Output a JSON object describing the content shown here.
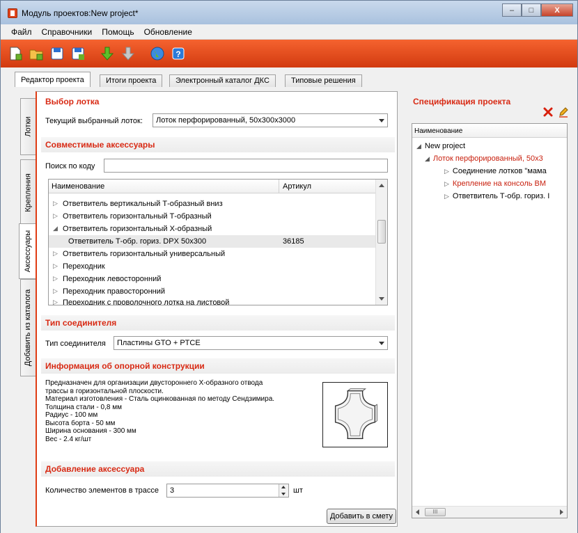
{
  "window": {
    "title": "Модуль проектов:New project*",
    "minimize": "–",
    "maximize": "□",
    "close": "X"
  },
  "menu": [
    "Файл",
    "Справочники",
    "Помощь",
    "Обновление"
  ],
  "toolbar": {
    "icons": [
      "new-document-icon",
      "open-folder-icon",
      "save-icon",
      "save-as-icon",
      "arrow-down-green-icon",
      "arrow-down-gray-icon",
      "globe-icon",
      "help-icon"
    ]
  },
  "tabs": [
    "Редактор проекта",
    "Итоги проекта",
    "Электронный каталог ДКС",
    "Типовые решения"
  ],
  "side_tabs": [
    "Лотки",
    "Крепления",
    "Аксессуары",
    "Добавить из каталога"
  ],
  "tray_selection": {
    "title": "Выбор лотка",
    "label": "Текущий выбранный лоток:",
    "value": "Лоток перфорированный, 50x300x3000"
  },
  "accessories": {
    "title": "Совместимые аксессуары",
    "search_label": "Поиск по коду",
    "search_value": "",
    "columns": [
      "Наименование",
      "Артикул"
    ],
    "rows": [
      {
        "toggle": "▷",
        "name": "Ответвитель вертикальный Т-образный вниз",
        "article": ""
      },
      {
        "toggle": "▷",
        "name": "Ответвитель горизонтальный Т-образный",
        "article": ""
      },
      {
        "toggle": "◢",
        "name": "Ответвитель горизонтальный Х-образный",
        "article": ""
      },
      {
        "toggle": "",
        "name": "Ответвитель Т-обр. гориз. DPX 50x300",
        "article": "36185"
      },
      {
        "toggle": "▷",
        "name": "Ответвитель горизонтальный универсальный",
        "article": ""
      },
      {
        "toggle": "▷",
        "name": "Переходник",
        "article": ""
      },
      {
        "toggle": "▷",
        "name": "Переходник левосторонний",
        "article": ""
      },
      {
        "toggle": "▷",
        "name": "Переходник правосторонний",
        "article": ""
      },
      {
        "toggle": "▷",
        "name": "Переходник с проволочного лотка на листовой",
        "article": ""
      }
    ]
  },
  "connector": {
    "title": "Тип соединителя",
    "label": "Тип соединителя",
    "value": "Пластины GTO + PTCE"
  },
  "support_info": {
    "title": "Информация об опорной конструкции",
    "lines": [
      "Предназначен для организации двустороннего Х-образного отвода",
      "трассы в горизонтальной плоскости.",
      "Материал изготовления - Сталь оцинкованная по методу Сендзимира.",
      "Толщина стали - 0,8 мм",
      "Радиус - 100 мм",
      "Высота борта - 50 мм",
      "Ширина основания - 300 мм",
      "Вес - 2.4 кг/шт"
    ]
  },
  "add_accessory": {
    "title": "Добавление аксессуара",
    "qty_label": "Количество элементов в трассе",
    "qty_value": "3",
    "unit": "шт",
    "button": "Добавить в смету"
  },
  "specification": {
    "title": "Спецификация проекта",
    "column": "Наименование",
    "nodes": [
      {
        "toggle": "◢",
        "label": "New project",
        "red": false,
        "level": 0
      },
      {
        "toggle": "◢",
        "label": "Лоток перфорированный, 50x3",
        "red": true,
        "level": 1
      },
      {
        "toggle": "▷",
        "label": "Соединение лотков \"мама",
        "red": false,
        "level": 2
      },
      {
        "toggle": "▷",
        "label": "Крепление на консоль ВМ",
        "red": true,
        "level": 2
      },
      {
        "toggle": "▷",
        "label": "Ответвитель Т-обр. гориз. I",
        "red": false,
        "level": 2
      }
    ],
    "scroll_thumb": "III"
  },
  "colors": {
    "accent": "#d82a14",
    "toolbar": "#e4471c"
  }
}
